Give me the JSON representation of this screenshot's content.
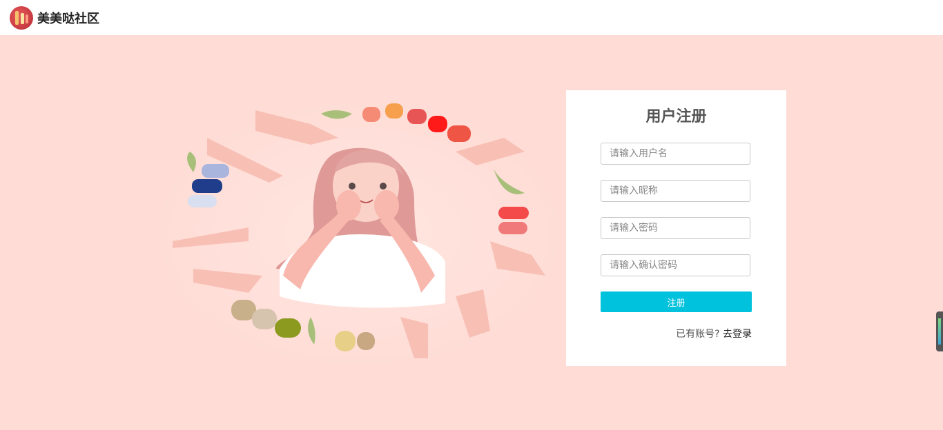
{
  "header": {
    "brand": "美美哒社区"
  },
  "form": {
    "title": "用户注册",
    "username_placeholder": "请输入用户名",
    "nickname_placeholder": "请输入昵称",
    "password_placeholder": "请输入密码",
    "confirm_placeholder": "请输入确认密码",
    "submit_label": "注册",
    "have_account_text": "已有账号?",
    "login_link": "去登录"
  },
  "colors": {
    "background": "#ffdcd6",
    "accent": "#00c2dc"
  }
}
